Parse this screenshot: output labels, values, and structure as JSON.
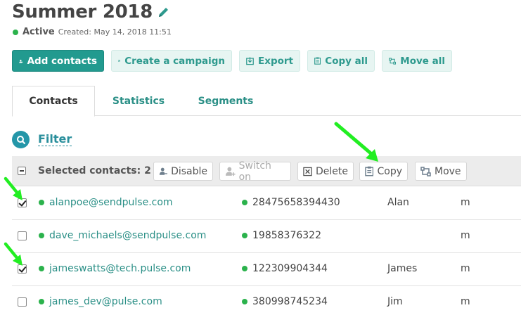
{
  "header": {
    "title": "Summer 2018",
    "status": "Active",
    "created": "Created: May 14, 2018 11:51"
  },
  "toolbar": {
    "add_contacts": "Add contacts",
    "create_campaign": "Create a campaign",
    "export": "Export",
    "copy_all": "Copy all",
    "move_all": "Move all"
  },
  "tabs": [
    {
      "label": "Contacts",
      "active": true
    },
    {
      "label": "Statistics",
      "active": false
    },
    {
      "label": "Segments",
      "active": false
    }
  ],
  "filter": {
    "label": "Filter"
  },
  "selection": {
    "label": "Selected contacts: 2",
    "disable": "Disable",
    "switch_on": "Switch on",
    "delete": "Delete",
    "copy": "Copy",
    "move": "Move"
  },
  "contacts": [
    {
      "email": "alanpoe@sendpulse.com",
      "phone": "28475658394430",
      "name": "Alan",
      "gender": "m",
      "checked": true
    },
    {
      "email": "dave_michaels@sendpulse.com",
      "phone": "19858376322",
      "name": "",
      "gender": "m",
      "checked": false
    },
    {
      "email": "jameswatts@tech.pulse.com",
      "phone": "122309904344",
      "name": "James",
      "gender": "m",
      "checked": true
    },
    {
      "email": "james_dev@pulse.com",
      "phone": "380998745234",
      "name": "Jim",
      "gender": "m",
      "checked": false
    }
  ],
  "colors": {
    "accent": "#229a8f",
    "light_button": "#e7f5f2",
    "status_green": "#2bb24c",
    "annotation_arrow": "#22ee22"
  }
}
